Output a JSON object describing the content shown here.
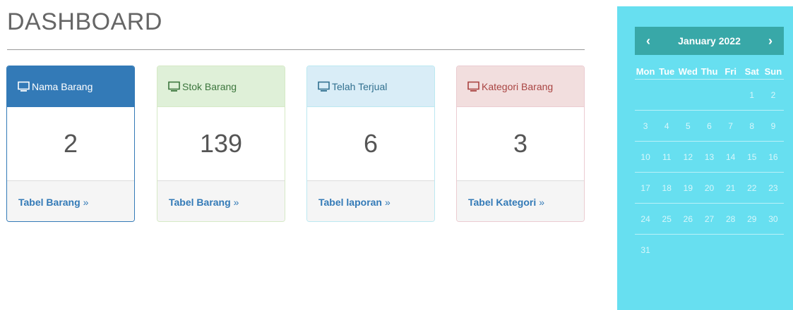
{
  "page": {
    "title": "DASHBOARD"
  },
  "cards": [
    {
      "label": "Nama Barang",
      "value": "2",
      "link": "Tabel Barang",
      "chevron": "»"
    },
    {
      "label": "Stok Barang",
      "value": "139",
      "link": "Tabel Barang",
      "chevron": "»"
    },
    {
      "label": "Telah Terjual",
      "value": "6",
      "link": "Tabel laporan",
      "chevron": "»"
    },
    {
      "label": "Kategori Barang",
      "value": "3",
      "link": "Tabel Kategori",
      "chevron": "»"
    }
  ],
  "icons": {
    "card_icon": "monitor-icon",
    "prev": "chevron-left-icon",
    "next": "chevron-right-icon"
  },
  "colors": {
    "primary": "#337ab7",
    "success_bg": "#dff0d8",
    "info_bg": "#d9edf7",
    "danger_bg": "#f2dede",
    "calendar_bg": "#67dff0",
    "calendar_header": "#38a8a8"
  },
  "calendar": {
    "month_label": "January 2022",
    "prev_glyph": "‹",
    "next_glyph": "›",
    "weekdays": [
      "Mon",
      "Tue",
      "Wed",
      "Thu",
      "Fri",
      "Sat",
      "Sun"
    ],
    "weeks": [
      [
        "",
        "",
        "",
        "",
        "",
        "1",
        "2"
      ],
      [
        "3",
        "4",
        "5",
        "6",
        "7",
        "8",
        "9"
      ],
      [
        "10",
        "11",
        "12",
        "13",
        "14",
        "15",
        "16"
      ],
      [
        "17",
        "18",
        "19",
        "20",
        "21",
        "22",
        "23"
      ],
      [
        "24",
        "25",
        "26",
        "27",
        "28",
        "29",
        "30"
      ],
      [
        "31",
        "",
        "",
        "",
        "",
        "",
        ""
      ]
    ]
  }
}
